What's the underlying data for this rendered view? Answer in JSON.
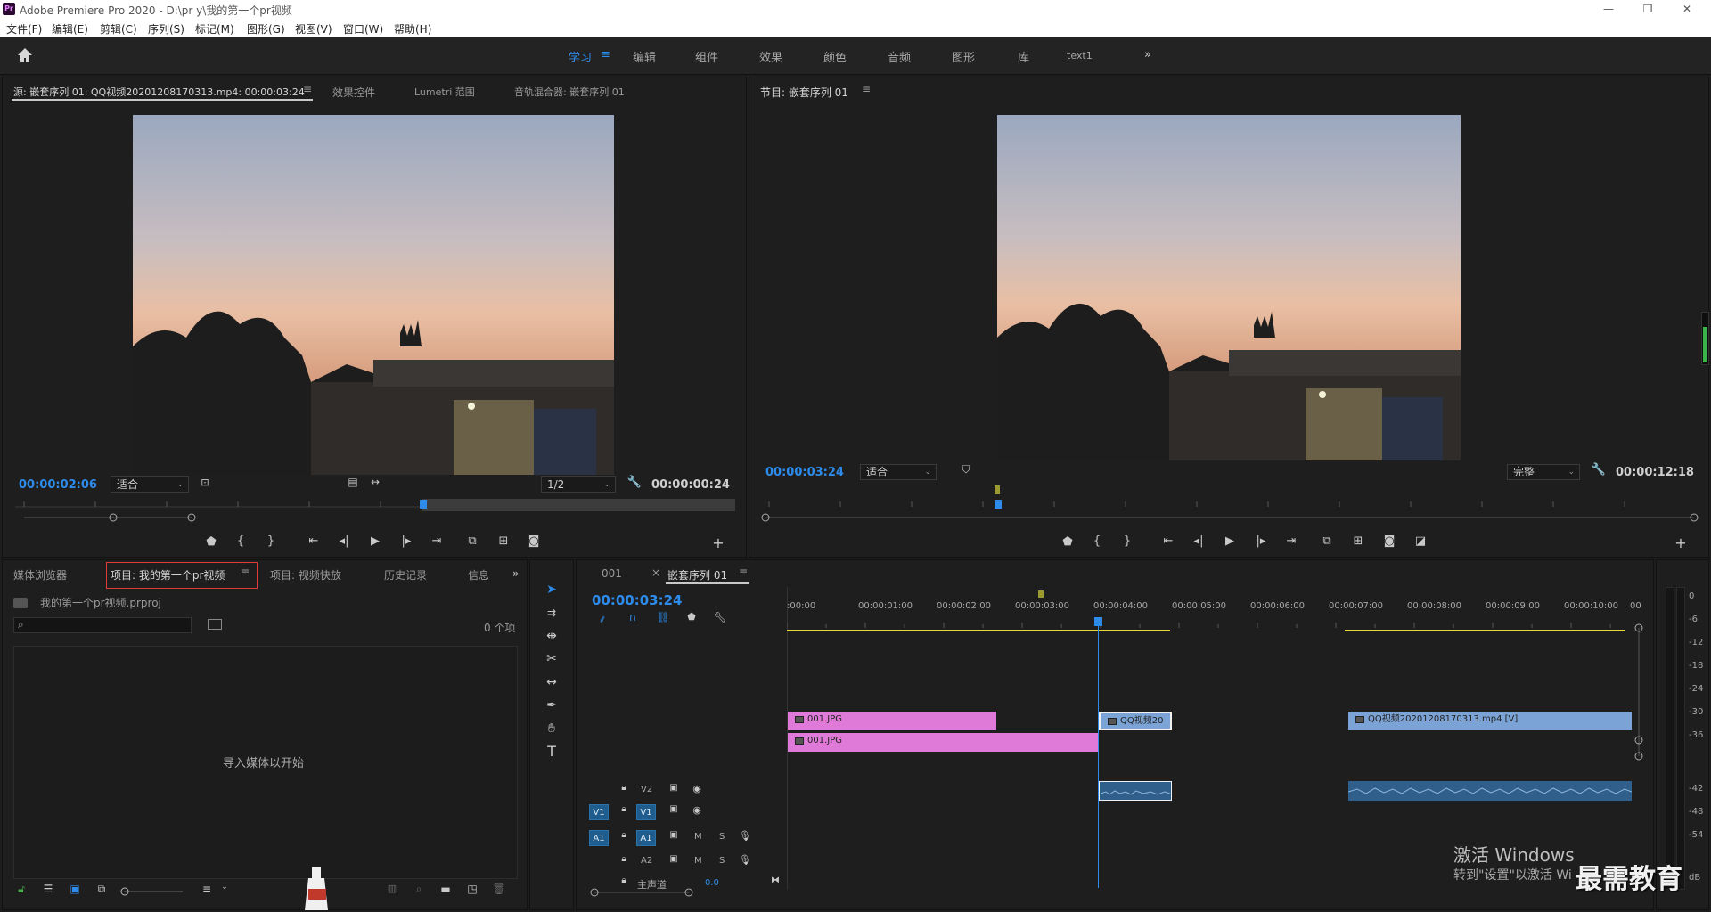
{
  "app": {
    "window_title": "Adobe Premiere Pro 2020 - D:\\pr y\\我的第一个pr视频",
    "logo_text": "Pr"
  },
  "menu": [
    "文件(F)",
    "编辑(E)",
    "剪辑(C)",
    "序列(S)",
    "标记(M)",
    "图形(G)",
    "视图(V)",
    "窗口(W)",
    "帮助(H)"
  ],
  "workspaces": {
    "tabs": [
      "学习",
      "编辑",
      "组件",
      "效果",
      "颜色",
      "音频",
      "图形",
      "库",
      "text1"
    ],
    "active": "学习",
    "menu_glyph": "≡",
    "overflow": "»"
  },
  "source_panel": {
    "tabs": [
      "源: 嵌套序列 01: QQ视频20201208170313.mp4: 00:00:03:24",
      "效果控件",
      "Lumetri 范围",
      "音轨混合器: 嵌套序列 01"
    ],
    "menu_glyph": "≡",
    "timecode": "00:00:02:06",
    "fit": "适合",
    "resolution": "1/2",
    "duration": "00:00:00:24",
    "playhead_fraction": 0.55
  },
  "program_panel": {
    "title": "节目: 嵌套序列 01",
    "menu_glyph": "≡",
    "timecode": "00:00:03:24",
    "fit": "适合",
    "quality": "完整",
    "duration": "00:00:12:18",
    "playhead_fraction": 0.31
  },
  "project_panel": {
    "tabs": [
      "媒体浏览器",
      "项目: 我的第一个pr视频",
      "项目: 视频快放",
      "历史记录",
      "信息"
    ],
    "menu_glyph": "≡",
    "overflow": "»",
    "project_file": "我的第一个pr视频.prproj",
    "item_count": "0 个项",
    "empty_text": "导入媒体以开始"
  },
  "timeline": {
    "tabs": [
      "001",
      "嵌套序列 01"
    ],
    "close_glyph": "×",
    "menu_glyph": "≡",
    "timecode": "00:00:03:24",
    "ruler": [
      ":00:00",
      "00:00:01:00",
      "00:00:02:00",
      "00:00:03:00",
      "00:00:04:00",
      "00:00:05:00",
      "00:00:06:00",
      "00:00:07:00",
      "00:00:08:00",
      "00:00:09:00",
      "00:00:10:00",
      "00"
    ],
    "tracks": {
      "v2": "V2",
      "v1_src": "V1",
      "v1": "V1",
      "a1_src": "A1",
      "a1": "A1",
      "a2": "A2",
      "m": "M",
      "s": "S",
      "master_label": "主声道",
      "master_value": "0.0"
    },
    "clips": {
      "v2_a": "001.JPG",
      "v2_b": "QQ视频20",
      "v2_c": "QQ视频20201208170313.mp4 [V]",
      "v1_a": "001.JPG"
    }
  },
  "meters": [
    "0",
    "-6",
    "-12",
    "-18",
    "-24",
    "-30",
    "-36",
    "-42",
    "-48",
    "-54",
    "dB"
  ],
  "watermark": {
    "activate_title": "激活 Windows",
    "activate_sub": "转到\"设置\"以激活 Wi",
    "brand": "最需教育"
  },
  "colors": {
    "accent": "#2d8ceb",
    "clip_pink": "#e07ad8",
    "clip_blue": "#7ba3d6",
    "audio_clip": "#2f5f8a",
    "highlight_red": "#e23b3b",
    "work_area": "#e8d93a"
  }
}
